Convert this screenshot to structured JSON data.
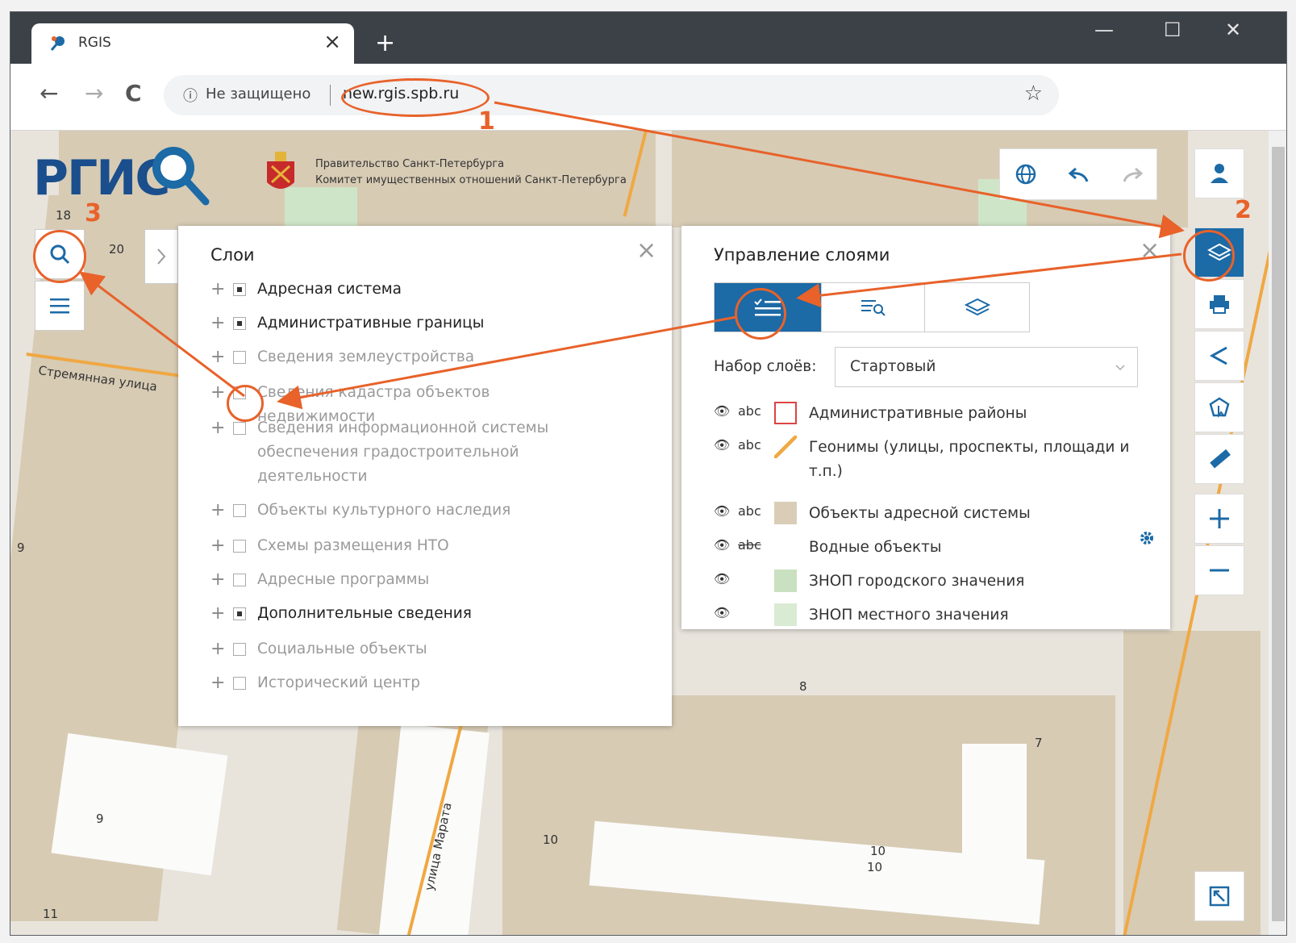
{
  "browser": {
    "tab_title": "RGIS",
    "tab_close": "×",
    "new_tab": "+",
    "minimize": "—",
    "maximize": "☐",
    "close": "✕",
    "back": "←",
    "forward": "→",
    "reload": "C",
    "info_icon": "ⓘ",
    "security_text": "Не защищено",
    "url": "new.rgis.spb.ru",
    "star": "☆"
  },
  "header": {
    "logo_text": "РГИС",
    "gov_line1": "Правительство Санкт-Петербурга",
    "gov_line2": "Комитет имущественных отношений Санкт-Петербурга"
  },
  "map_labels": {
    "n18": "18",
    "n20": "20",
    "n9a": "9",
    "n8": "8",
    "n7": "7",
    "n10a": "10",
    "n10b": "10",
    "n10c": "10",
    "n9b": "9",
    "n11": "11",
    "n3": "3",
    "street1": "Стремянная улица",
    "street2": "улица Марата"
  },
  "layers_panel": {
    "title": "Слои",
    "close": "×",
    "items": [
      {
        "label": "Адресная система",
        "checked": true,
        "dim": false
      },
      {
        "label": "Административные границы",
        "checked": true,
        "dim": false
      },
      {
        "label": "Сведения землеустройства",
        "checked": false,
        "dim": true
      },
      {
        "label": "Сведения кадастра объектов недвижимости",
        "checked": false,
        "dim": true
      },
      {
        "label": "Сведения информационной системы обеспечения градостроительной деятельности",
        "checked": false,
        "dim": true
      },
      {
        "label": "Объекты культурного наследия",
        "checked": false,
        "dim": true
      },
      {
        "label": "Схемы размещения НТО",
        "checked": false,
        "dim": true
      },
      {
        "label": "Адресные программы",
        "checked": false,
        "dim": true
      },
      {
        "label": "Дополнительные сведения",
        "checked": true,
        "dim": false
      },
      {
        "label": "Социальные объекты",
        "checked": false,
        "dim": true
      },
      {
        "label": "Исторический центр",
        "checked": false,
        "dim": true
      }
    ]
  },
  "layer_manager": {
    "title": "Управление слоями",
    "close": "×",
    "set_label": "Набор слоёв:",
    "set_value": "Стартовый",
    "eye": "👁",
    "abc": "abc",
    "rows": [
      {
        "label": "Административные районы",
        "abc": "abc",
        "swatch": "outline-red"
      },
      {
        "label": "Геонимы (улицы, проспекты, площади и т.п.)",
        "abc": "abc",
        "swatch": "line-orange"
      },
      {
        "label": "Объекты адресной системы",
        "abc": "abc",
        "swatch": "#d9cdb7"
      },
      {
        "label": "Водные объекты",
        "abc": "abc",
        "swatch": "none"
      },
      {
        "label": "ЗНОП городского значения",
        "abc": "",
        "swatch": "#c9e1c0"
      },
      {
        "label": "ЗНОП местного значения",
        "abc": "",
        "swatch": "#d9ebd3"
      }
    ]
  },
  "annotations": {
    "n1": "1",
    "n2": "2",
    "n3": "3"
  },
  "colors": {
    "accent_blue": "#1c6aa6",
    "annotation_orange": "#e8622a",
    "building": "#d7cbb4"
  }
}
